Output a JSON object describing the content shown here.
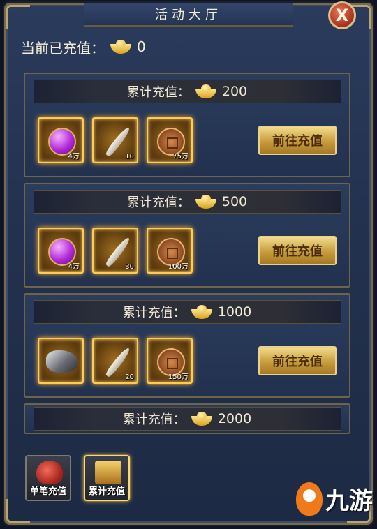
{
  "window": {
    "title": "活动大厅",
    "close_label": "X"
  },
  "current": {
    "label": "当前已充值：",
    "value": "0"
  },
  "tiers": [
    {
      "label": "累计充值：",
      "amount": "200",
      "button_label": "前往充值",
      "rewards": [
        {
          "icon": "purple-orb-icon",
          "count": "4万"
        },
        {
          "icon": "feather-icon",
          "count": "10"
        },
        {
          "icon": "copper-coin-icon",
          "count": "75万"
        }
      ]
    },
    {
      "label": "累计充值：",
      "amount": "500",
      "button_label": "前往充值",
      "rewards": [
        {
          "icon": "purple-orb-icon",
          "count": "4万"
        },
        {
          "icon": "feather-icon",
          "count": "30"
        },
        {
          "icon": "copper-coin-icon",
          "count": "100万"
        }
      ]
    },
    {
      "label": "累计充值：",
      "amount": "1000",
      "button_label": "前往充值",
      "rewards": [
        {
          "icon": "ore-icon",
          "count": ""
        },
        {
          "icon": "feather-icon",
          "count": "20"
        },
        {
          "icon": "copper-coin-icon",
          "count": "150万"
        }
      ]
    },
    {
      "label": "累计充值：",
      "amount": "2000"
    }
  ],
  "tabs": [
    {
      "label": "单笔充值",
      "icon": "red-bag-icon",
      "active": false
    },
    {
      "label": "累计充值",
      "icon": "treasure-chest-icon",
      "active": true
    }
  ],
  "watermark": {
    "text": "九游"
  },
  "colors": {
    "accent_gold": "#ffcc4d",
    "button_gold": "#c79c3d",
    "panel_blue": "#23324f"
  }
}
